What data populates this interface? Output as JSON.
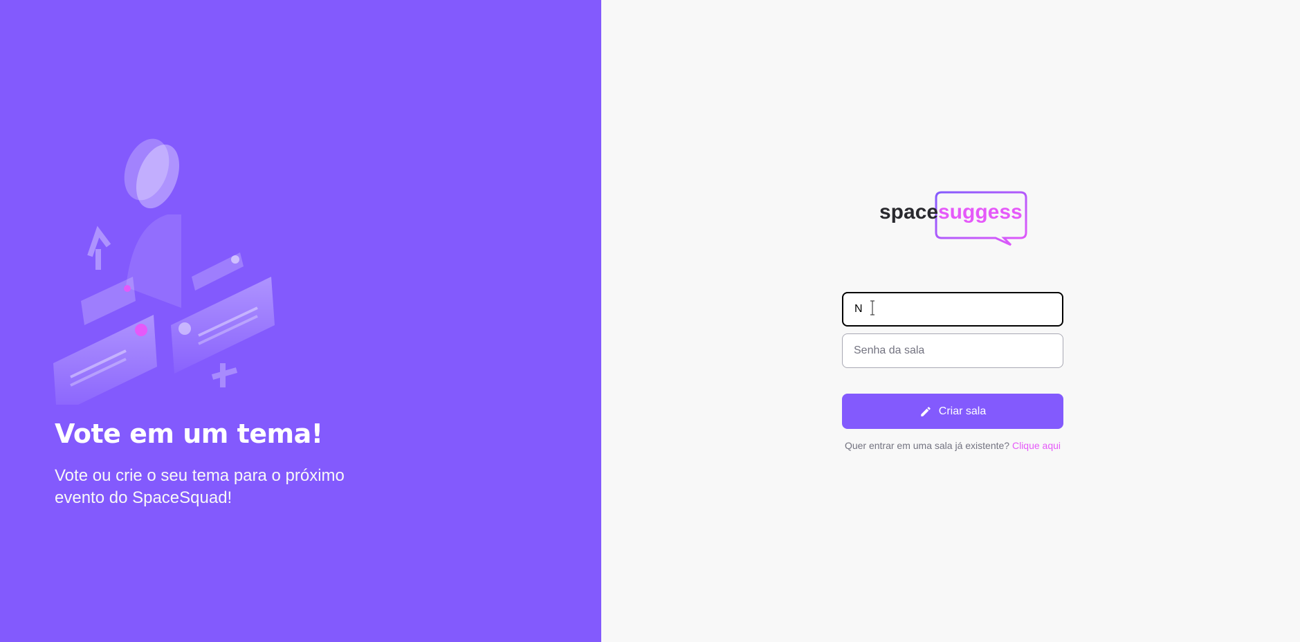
{
  "aside": {
    "title": "Vote em um tema!",
    "subtitle": "Vote ou crie o seu tema para o próximo evento do SpaceSquad!",
    "illustration_icon": "voting-illustration"
  },
  "logo": {
    "part1": "space",
    "part2": "suggess"
  },
  "form": {
    "name_value": "N",
    "password_placeholder": "Senha da sala",
    "submit_label": "Criar sala",
    "submit_icon": "pencil-icon"
  },
  "footer": {
    "question": "Quer entrar em uma sala já existente?",
    "link_label": "Clique aqui"
  },
  "colors": {
    "primary": "#835afd",
    "accent": "#e559f9",
    "background": "#f8f8f8",
    "text_dark": "#29292e"
  }
}
